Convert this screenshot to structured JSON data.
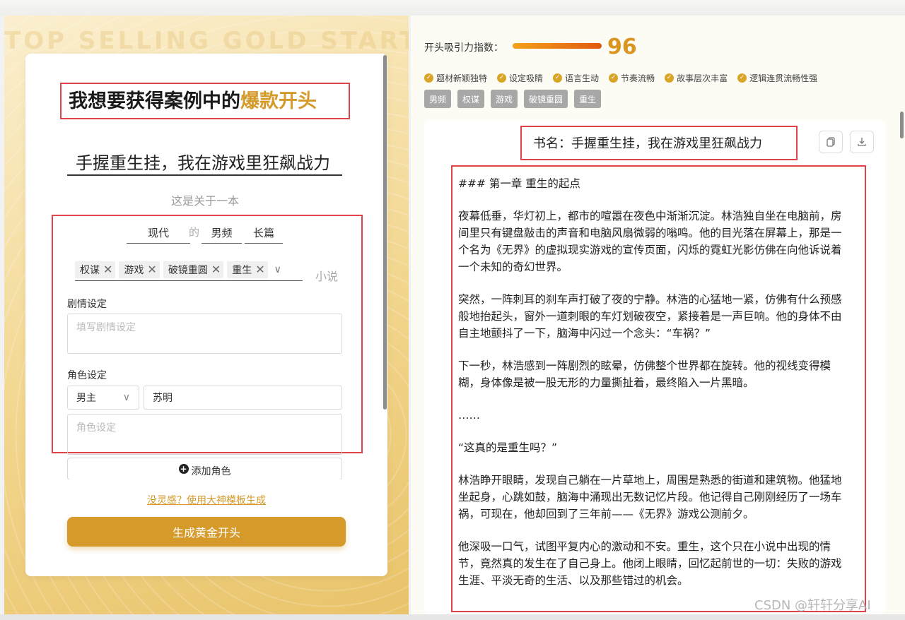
{
  "left": {
    "watermark": "TOP SELLING GOLD START",
    "headline_prefix": "我想要获得案例中的",
    "headline_highlight": "爆款开头",
    "title_value": "手握重生挂，我在游戏里狂飙战力",
    "about_text": "这是关于一本",
    "era": "现代",
    "de": "的",
    "channel": "男频",
    "length": "长篇",
    "tags": [
      "权谋",
      "游戏",
      "破镜重圆",
      "重生"
    ],
    "suffix": "小说",
    "plot_label": "剧情设定",
    "plot_placeholder": "填写剧情设定",
    "role_label": "角色设定",
    "role_type": "男主",
    "role_name": "苏明",
    "role_placeholder": "角色设定",
    "add_role": "添加角色",
    "template_link": "没灵感？使用大神模板生成",
    "generate_button": "生成黄金开头"
  },
  "right": {
    "score_label": "开头吸引力指数：",
    "score_value": "96",
    "score_fraction": 0.96,
    "checks": [
      "题材新颖独特",
      "设定吸睛",
      "语言生动",
      "节奏流畅",
      "故事层次丰富",
      "逻辑连贯流畅性强"
    ],
    "genre_tags": [
      "男频",
      "权谋",
      "游戏",
      "破镜重圆",
      "重生"
    ],
    "book_title": "书名：手握重生挂，我在游戏里狂飙战力",
    "paragraphs": [
      "### 第一章 重生的起点",
      "夜幕低垂，华灯初上，都市的喧嚣在夜色中渐渐沉淀。林浩独自坐在电脑前，房间里只有键盘敲击的声音和电脑风扇微弱的嗡鸣。他的目光落在屏幕上，那是一个名为《无界》的虚拟现实游戏的宣传页面，闪烁的霓虹光影仿佛在向他诉说着一个未知的奇幻世界。",
      "突然，一阵刺耳的刹车声打破了夜的宁静。林浩的心猛地一紧，仿佛有什么预感般地抬起头，窗外一道刺眼的车灯划破夜空，紧接着是一声巨响。他的身体不由自主地颤抖了一下，脑海中闪过一个念头：“车祸？”",
      "下一秒，林浩感到一阵剧烈的眩晕，仿佛整个世界都在旋转。他的视线变得模糊，身体像是被一股无形的力量撕扯着，最终陷入一片黑暗。",
      "……",
      "“这真的是重生吗？”",
      "林浩睁开眼睛，发现自己躺在一片草地上，周围是熟悉的街道和建筑物。他猛地坐起身，心跳如鼓，脑海中涌现出无数记忆片段。他记得自己刚刚经历了一场车祸，可现在，他却回到了三年前——《无界》游戏公测前夕。",
      "他深吸一口气，试图平复内心的激动和不安。重生，这个只在小说中出现的情节，竟然真的发生在了自己身上。他闭上眼睛，回忆起前世的一切：失败的游戏生涯、平淡无奇的生活、以及那些错过的机会。"
    ]
  },
  "watermark_csdn": "CSDN @轩轩分享AI",
  "colors": {
    "accent": "#d69a2b",
    "highlight_border": "#e0424a",
    "score": "#d9951f"
  }
}
